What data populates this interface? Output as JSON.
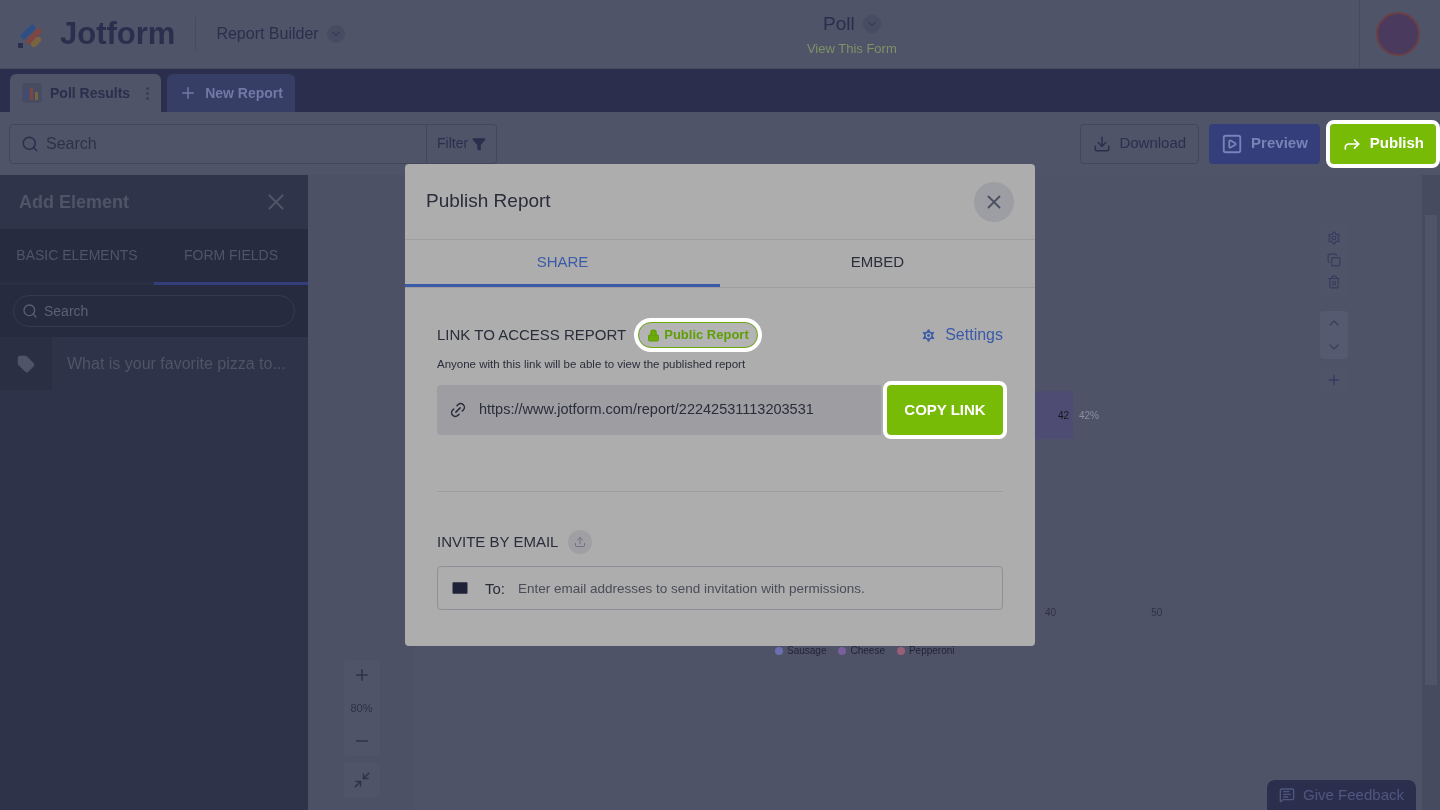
{
  "header": {
    "brand": "Jotform",
    "app_switcher": "Report Builder",
    "form_title": "Poll",
    "form_link": "View This Form"
  },
  "report_tabs": [
    {
      "label": "Poll Results",
      "selected": true,
      "kind": "report"
    },
    {
      "label": "New Report",
      "selected": false,
      "kind": "add"
    }
  ],
  "toolbar": {
    "search_placeholder": "Search",
    "filter": "Filter",
    "buttons": [
      {
        "label": "Download",
        "kind": "download",
        "highlighted": false
      },
      {
        "label": "Preview",
        "kind": "preview",
        "highlighted": false
      },
      {
        "label": "Publish",
        "kind": "publish",
        "highlighted": true
      }
    ]
  },
  "sidebar": {
    "title": "Add Element",
    "tabs": [
      {
        "label": "BASIC ELEMENTS",
        "selected": false
      },
      {
        "label": "FORM FIELDS",
        "selected": true
      }
    ],
    "search_placeholder": "Search",
    "items": [
      "What is your favorite pizza to..."
    ]
  },
  "zoom": {
    "level": "80%"
  },
  "chart": {
    "bar_value": "42",
    "bar_percent": "42%",
    "ticks": [
      "40",
      "50"
    ],
    "legend": [
      {
        "name": "Sausage",
        "color": "#6b6fb0"
      },
      {
        "name": "Cheese",
        "color": "#7a5f9a"
      },
      {
        "name": "Pepperoni",
        "color": "#9a5f78"
      }
    ]
  },
  "dialog": {
    "title": "Publish Report",
    "tabs": [
      {
        "label": "SHARE",
        "selected": true
      },
      {
        "label": "EMBED",
        "selected": false
      }
    ],
    "link_section": {
      "heading": "LINK TO ACCESS REPORT",
      "badge": "Public Report",
      "badge_highlighted": true,
      "settings": "Settings",
      "hint": "Anyone with this link will be able to view the published report",
      "url": "https://www.jotform.com/report/22242531113203531",
      "copy": "COPY LINK",
      "copy_highlighted": true
    },
    "invite_section": {
      "heading": "INVITE BY EMAIL",
      "to_label": "To:",
      "placeholder": "Enter email addresses to send invitation with permissions."
    }
  },
  "feedback": "Give Feedback"
}
